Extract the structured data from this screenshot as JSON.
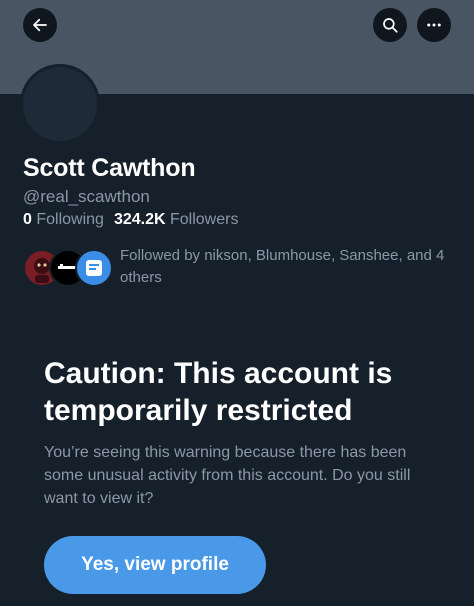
{
  "header": {
    "back_icon": "arrow-left-icon",
    "search_icon": "search-icon",
    "more_icon": "more-horizontal-icon"
  },
  "profile": {
    "name": "Scott Cawthon",
    "handle": "@real_scawthon",
    "following_count": "0",
    "following_label": "Following",
    "followers_count": "324.2K",
    "followers_label": "Followers",
    "followed_by_text": "Followed by nikson, Blumhouse, Sanshee, and 4 others"
  },
  "warning": {
    "title": "Caution: This account is temporarily restricted",
    "body": "You’re seeing this warning because there has been some unusual activity from this account. Do you still want to view it?",
    "button_label": "Yes, view profile"
  },
  "colors": {
    "background": "#15202b",
    "banner": "#4a5564",
    "accent": "#4a99e9",
    "secondary_text": "#8b98a5"
  }
}
